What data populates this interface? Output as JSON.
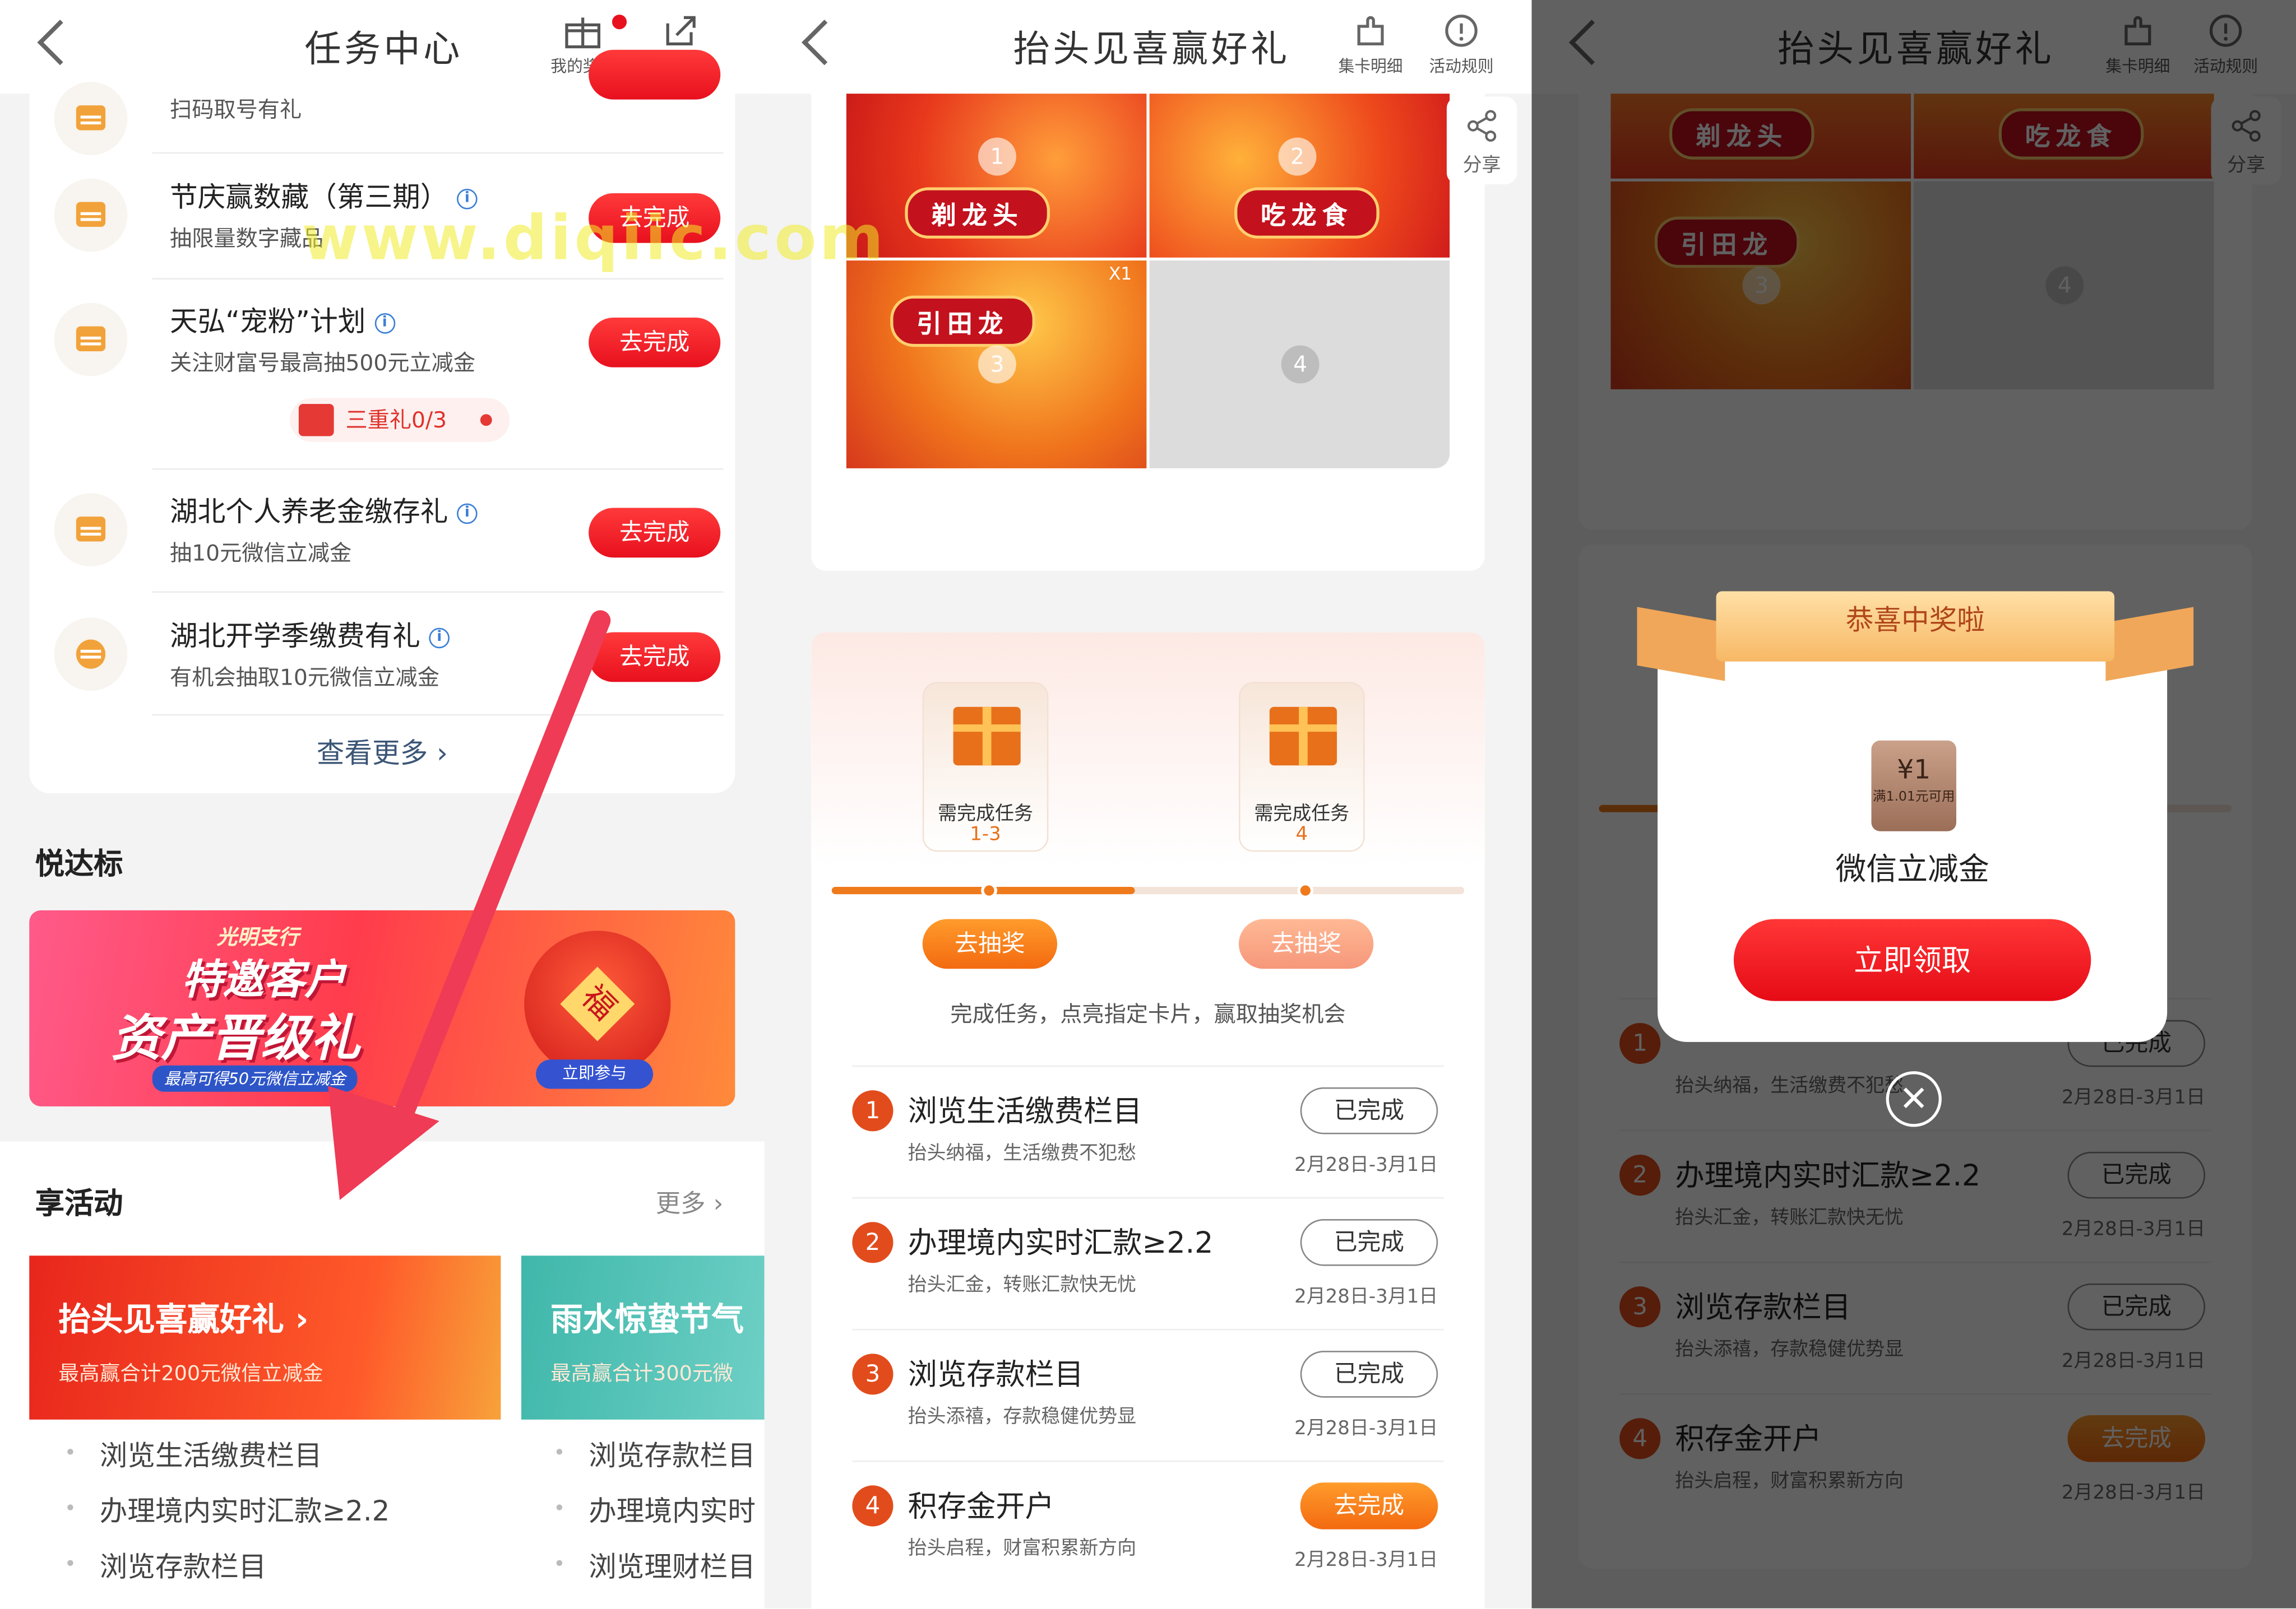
{
  "panel1": {
    "title": "任务中心",
    "my_prizes": "我的奖品",
    "share": "分享",
    "top_partial_sub": "扫码取号有礼",
    "tasks": [
      {
        "title": "节庆赢数藏（第三期）",
        "sub": "抽限量数字藏品",
        "btn": "去完成"
      },
      {
        "title": "天弘“宠粉”计划",
        "sub": "关注财富号最高抽500元立减金",
        "btn": "去完成"
      },
      {
        "title": "湖北个人养老金缴存礼",
        "sub": "抽10元微信立减金",
        "btn": "去完成"
      },
      {
        "title": "湖北开学季缴费有礼",
        "sub": "有机会抽取10元微信立减金",
        "btn": "去完成"
      }
    ],
    "triple_gift": "三重礼0/3",
    "view_more": "查看更多 ›",
    "section_yueda": "悦达标",
    "banner": {
      "line1": "光明支行",
      "line2": "特邀客户",
      "line3": "资产晋级礼",
      "line4": "最高可得50元微信立减金",
      "join": "立即参与",
      "fu": "福"
    },
    "section_activity": "享活动",
    "more": "更多 ›",
    "activity1": {
      "title": "抬头见喜赢好礼 ›",
      "sub": "最高赢合计200元微信立减金"
    },
    "activity2": {
      "title": "雨水惊蛰节气",
      "sub": "最高赢合计300元微"
    },
    "list1": [
      "浏览生活缴费栏目",
      "办理境内实时汇款≥2.2",
      "浏览存款栏目"
    ],
    "list2": [
      "浏览存款栏目",
      "办理境内实时",
      "浏览理财栏目"
    ]
  },
  "panel2": {
    "title": "抬头见喜赢好礼",
    "card_detail": "集卡明细",
    "rules": "活动规则",
    "share": "分享",
    "cards": [
      {
        "num": "1",
        "name": "剃龙头"
      },
      {
        "num": "2",
        "name": "吃龙食"
      },
      {
        "num": "3",
        "name": "引田龙",
        "count": "X1"
      },
      {
        "num": "4"
      }
    ],
    "gift_a": {
      "need": "需完成任务",
      "range": "1-3"
    },
    "gift_b": {
      "need": "需完成任务",
      "range": "4"
    },
    "draw": "去抽奖",
    "hint": "完成任务，点亮指定卡片，赢取抽奖机会",
    "progress": 0.48,
    "tasks": [
      {
        "num": "1",
        "title": "浏览生活缴费栏目",
        "sub": "抬头纳福，生活缴费不犯愁",
        "btn": "已完成",
        "date": "2月28日-3月1日"
      },
      {
        "num": "2",
        "title": "办理境内实时汇款≥2.2",
        "sub": "抬头汇金，转账汇款快无忧",
        "btn": "已完成",
        "date": "2月28日-3月1日"
      },
      {
        "num": "3",
        "title": "浏览存款栏目",
        "sub": "抬头添禧，存款稳健优势显",
        "btn": "已完成",
        "date": "2月28日-3月1日"
      },
      {
        "num": "4",
        "title": "积存金开户",
        "sub": "抬头启程，财富积累新方向",
        "btn": "去完成",
        "date": "2月28日-3月1日"
      }
    ]
  },
  "panel3": {
    "ribbon": "恭喜中奖啦",
    "coupon_value": "¥1",
    "coupon_cond": "满1.01元可用",
    "prize_name": "微信立减金",
    "claim": "立即领取",
    "close": "✕"
  },
  "watermark": "www.diqiic.com",
  "colors": {
    "red": "#e8101e",
    "orange": "#ef7a1c",
    "accent_blue": "#3a7fd5"
  }
}
